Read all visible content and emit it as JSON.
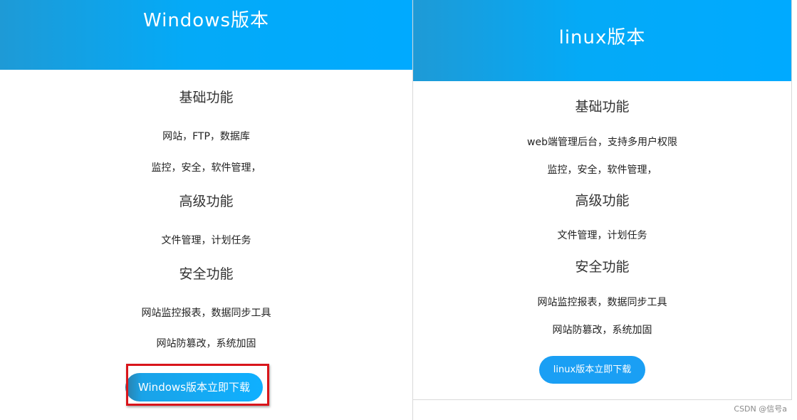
{
  "windows": {
    "title": "Windows版本",
    "section_basic": "基础功能",
    "basic_items": [
      "网站，FTP，数据库",
      "监控，安全，软件管理，"
    ],
    "section_advanced": "高级功能",
    "advanced_items": [
      "文件管理，计划任务"
    ],
    "section_security": "安全功能",
    "security_items": [
      "网站监控报表，数据同步工具",
      "网站防篡改，系统加固"
    ],
    "button_label": "Windows版本立即下载"
  },
  "linux": {
    "title": "linux版本",
    "section_basic": "基础功能",
    "basic_items": [
      "web端管理后台，支持多用户权限",
      "监控，安全，软件管理，"
    ],
    "section_advanced": "高级功能",
    "advanced_items": [
      "文件管理，计划任务"
    ],
    "section_security": "安全功能",
    "security_items": [
      "网站监控报表，数据同步工具",
      "网站防篡改，系统加固"
    ],
    "button_label": "linux版本立即下载"
  },
  "colors": {
    "header_blue": "#00aaff",
    "button_blue": "#1a9ff4",
    "highlight_red": "#d9151b"
  },
  "watermark": "CSDN @信号a"
}
